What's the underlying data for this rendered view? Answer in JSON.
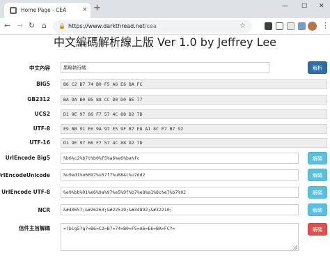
{
  "browser": {
    "tab_title": "Home Page - CEA",
    "tab_close": "×",
    "new_tab": "+",
    "url_host": "https://www.darkthread.net",
    "url_path": "/cea",
    "win_min": "—",
    "win_max": "☐",
    "win_close": "✕"
  },
  "page": {
    "title": "中文編碼解析線上版 Ver 1.0 by Jeffrey Lee"
  },
  "fields": {
    "chinese": {
      "label": "中文內容",
      "value": "黑暗執行緒",
      "button": "解析"
    },
    "big5": {
      "label": "BIG5",
      "value": "B6 C2 B7 74 B0 F5 A6 E6 BA FC"
    },
    "gb2312": {
      "label": "GB2312",
      "value": "BA DA B0 B5 88 CC D0 D0 BE 77"
    },
    "ucs2": {
      "label": "UCS2",
      "value": "D1 9E 97 66 F7 57 4C 88 D2 7D"
    },
    "utf8": {
      "label": "UTF-8",
      "value": "E9 BB 91 E6 9A 97 E5 9F B7 E8 A1 8C E7 B7 92"
    },
    "utf16": {
      "label": "UTF-16",
      "value": "D1 9E 97 66 F7 57 4C 88 D2 7D"
    },
    "url_big5": {
      "label": "UrlEncode Big5",
      "value": "%b6%c2%b7t%b0%f5%a6%e6%ba%fc",
      "button": "解碼"
    },
    "url_unicode": {
      "label": "UrlEncodeUnicode",
      "value": "%u9ed1%u6697%u57f7%u884c%u7dd2",
      "button": "解碼"
    },
    "url_utf8": {
      "label": "UrlEncode UTF-8",
      "value": "%e9%bb%91%e6%9a%97%e5%9f%b7%e8%a1%8c%e7%b7%92",
      "button": "解碼"
    },
    "ncr": {
      "label": "NCR",
      "value": "&#40657;&#26263;&#22519;&#34892;&#32210;",
      "button": "解碼"
    },
    "mail_subject": {
      "label": "信件主旨解碼",
      "value": "=?big5?q?=B6=C2=B7=74=B0=F5=A6=E6=BA=FC?=",
      "button": "解碼"
    }
  },
  "colors": {
    "primary": "#2f6da6",
    "info": "#5bc0de",
    "danger": "#d9534f"
  }
}
